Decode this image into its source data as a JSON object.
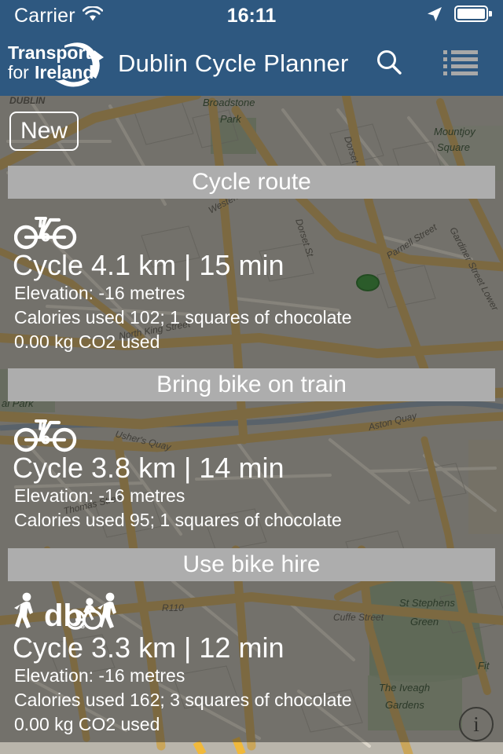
{
  "status_bar": {
    "carrier": "Carrier",
    "time": "16:11",
    "wifi_icon": "wifi-icon",
    "location_icon": "location-arrow-icon",
    "battery_icon": "battery-full-icon"
  },
  "nav_bar": {
    "logo_line1": "Transport",
    "logo_line2": "for",
    "logo_line3": "Ireland",
    "title": "Dublin Cycle Planner",
    "search_icon": "search-icon",
    "menu_icon": "list-menu-icon"
  },
  "map_overlay": {
    "new_button": "New",
    "info_button": "i"
  },
  "colors": {
    "nav_blue": "#2e5880",
    "section_gray": "#adadad",
    "text_white": "#ffffff",
    "map_road": "#c9a55a",
    "map_park": "#8fa07e"
  },
  "routes": [
    {
      "header": "Cycle route",
      "icon": "bicycle-icon",
      "title": "Cycle 4.1 km | 15 min",
      "details": [
        "Elevation: -16 metres",
        "Calories used 102; 1 squares of chocolate",
        "0.00 kg CO2 used"
      ]
    },
    {
      "header": "Bring bike on train",
      "icon": "bicycle-icon",
      "title": "Cycle 3.8 km | 14 min",
      "details": [
        "Elevation: -16 metres",
        "Calories used 95; 1 squares of chocolate"
      ]
    },
    {
      "header": "Use bike hire",
      "icon": "walk-dublinbikes-walk-icon",
      "title": "Cycle 3.3 km | 12 min",
      "details": [
        "Elevation: -16 metres",
        "Calories used 162; 3 squares of chocolate",
        "0.00 kg CO2 used"
      ]
    }
  ],
  "map_labels": [
    "DUBLIN",
    "Broadstone",
    "Park",
    "Mountjoy",
    "Square",
    "Dorset St",
    "Dorset St",
    "Western Way",
    "Parnell Street",
    "Gardiner Street Lower",
    "North King Street",
    "Thomas Street",
    "Usher's Quay",
    "Aston Quay",
    "al Park",
    "R110",
    "Cuffe Street",
    "St Stephens",
    "Green",
    "The Iveagh",
    "Gardens"
  ]
}
